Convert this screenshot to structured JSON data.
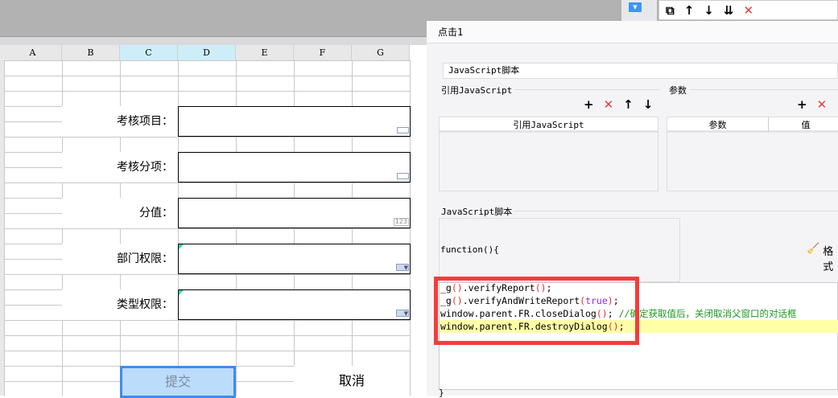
{
  "sheet": {
    "columns": [
      "A",
      "B",
      "C",
      "D",
      "E",
      "F",
      "G"
    ],
    "fields": [
      {
        "label": "考核项目：",
        "type": "text"
      },
      {
        "label": "考核分项：",
        "type": "text"
      },
      {
        "label": "分值：",
        "type": "number",
        "badge": "123"
      },
      {
        "label": "部门权限：",
        "type": "combo"
      },
      {
        "label": "类型权限：",
        "type": "combo"
      }
    ],
    "submit_label": "提交",
    "cancel_label": "取消"
  },
  "toolbar": {
    "icons": [
      "copy-icon",
      "arrow-up-icon",
      "arrow-down-icon",
      "move-bottom-icon",
      "delete-icon"
    ]
  },
  "dialog": {
    "title": "点击1",
    "type_value": "JavaScript脚本",
    "ref_js": {
      "legend": "引用JavaScript",
      "column": "引用JavaScript"
    },
    "params": {
      "legend": "参数",
      "columns": [
        "参数",
        "值"
      ]
    },
    "script": {
      "legend": "JavaScript脚本",
      "header": "function(){",
      "format_label": "格式",
      "footer": "}",
      "lines": {
        "l1a": "_g",
        "l1b": "()",
        ".l1c": "",
        "l1c": ".verifyReport",
        "l1d": "()",
        "l1e": ";",
        "l2a": "_g",
        "l2b": "()",
        "l2c": ".verifyAndWriteReport",
        "l2d": "(",
        "l2e": "true",
        "l2f": ")",
        "l2g": ";",
        "l3a": "window.parent.FR.closeDialog",
        "l3b": "()",
        "l3c": "; ",
        "l3d": "//确定获取值后，关闭取消父窗口的对话框",
        "l4a": "window.parent.FR.destroyDialog",
        "l4b": "()",
        "l4c": ";"
      }
    }
  },
  "colors": {
    "highlight_box": "#f53c3c",
    "selection": "#3c8cf0",
    "comment": "#1a9a1a"
  }
}
